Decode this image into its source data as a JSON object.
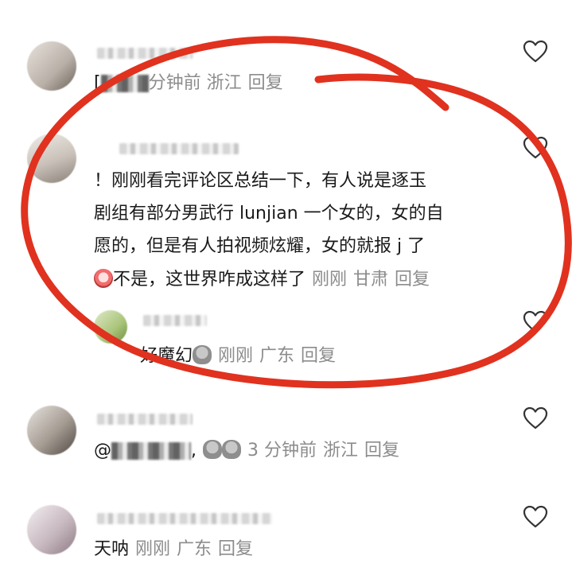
{
  "icons": {
    "like": "heart-outline-icon"
  },
  "colors": {
    "meta": "#8c8c8c",
    "annotation": "#e0321f"
  },
  "comments": [
    {
      "obscured_prefix": "[",
      "meta": "分钟前 浙江",
      "reply": "回复"
    },
    {
      "line1": "！刚刚看完评论区总结一下，有人说是逐玉",
      "line2": "剧组有部分男武行 lunjian 一个女的，女的自",
      "line3": "愿的，但是有人拍视频炫耀，女的就报 j 了",
      "line4": "不是，这世界咋成这样了",
      "time": "刚刚",
      "region": "甘肃",
      "reply": "回复",
      "subreply": {
        "text": "好魔幻",
        "time": "刚刚",
        "region": "广东",
        "reply": "回复"
      }
    },
    {
      "at": "@",
      "comma": ",",
      "time": "3 分钟前",
      "region": "浙江",
      "reply": "回复"
    },
    {
      "text": "天呐",
      "time": "刚刚",
      "region": "广东",
      "reply": "回复"
    }
  ]
}
